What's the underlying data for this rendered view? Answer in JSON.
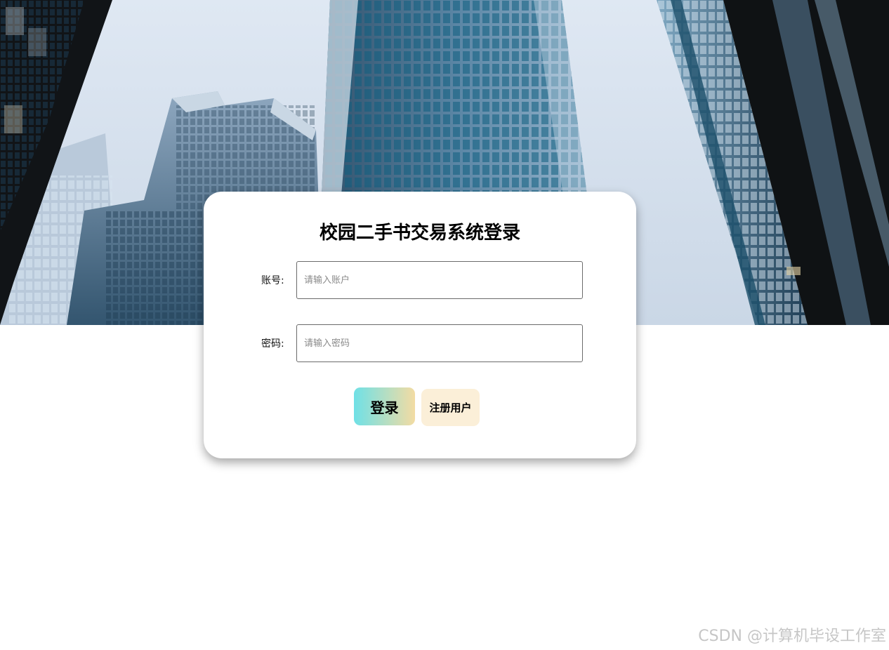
{
  "login": {
    "title": "校园二手书交易系统登录",
    "account_label": "账号:",
    "account_placeholder": "请输入账户",
    "account_value": "",
    "password_label": "密码:",
    "password_placeholder": "请输入密码",
    "password_value": "",
    "login_button": "登录",
    "register_button": "注册用户"
  },
  "watermark": {
    "text": "CSDN @计算机毕设工作室"
  },
  "colors": {
    "login_button_gradient_start": "#6fe0e6",
    "login_button_gradient_end": "#f3dca3",
    "register_button_bg": "#fbefd8",
    "card_bg": "#ffffff"
  },
  "background": {
    "image": "city-skyscrapers-photo"
  }
}
